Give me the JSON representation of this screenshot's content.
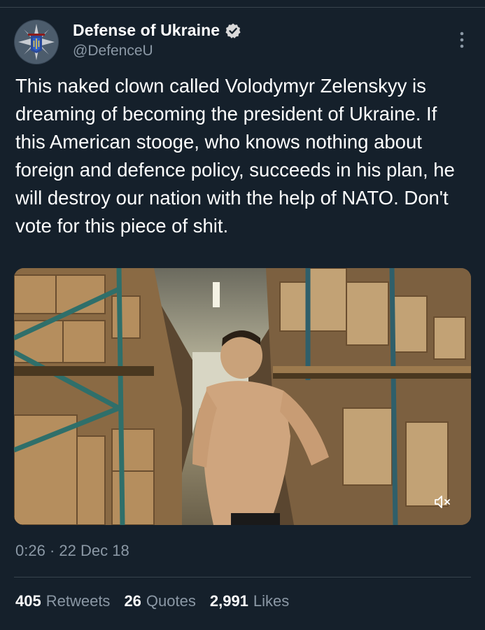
{
  "author": {
    "display_name": "Defense of Ukraine",
    "handle": "@DefenceU",
    "verified": true,
    "avatar_icon": "ukraine-defense-emblem-icon"
  },
  "tweet": {
    "text": "This naked clown called Volodymyr Zelenskyy is dreaming of becoming the president of Ukraine. If this American stooge, who knows nothing about foreign and defence policy, succeeds in his plan, he will destroy our nation with the help of NATO. Don't vote for this piece of shit.",
    "time": "0:26",
    "separator": "·",
    "date": "22 Dec 18"
  },
  "media": {
    "type": "video",
    "icons": [
      "mute-icon"
    ]
  },
  "stats": {
    "retweets_count": "405",
    "retweets_label": "Retweets",
    "quotes_count": "26",
    "quotes_label": "Quotes",
    "likes_count": "2,991",
    "likes_label": "Likes"
  },
  "colors": {
    "background": "#15202b",
    "secondary_text": "#8b98a5",
    "divider": "#38444d",
    "verified": "#d9d9d9"
  }
}
